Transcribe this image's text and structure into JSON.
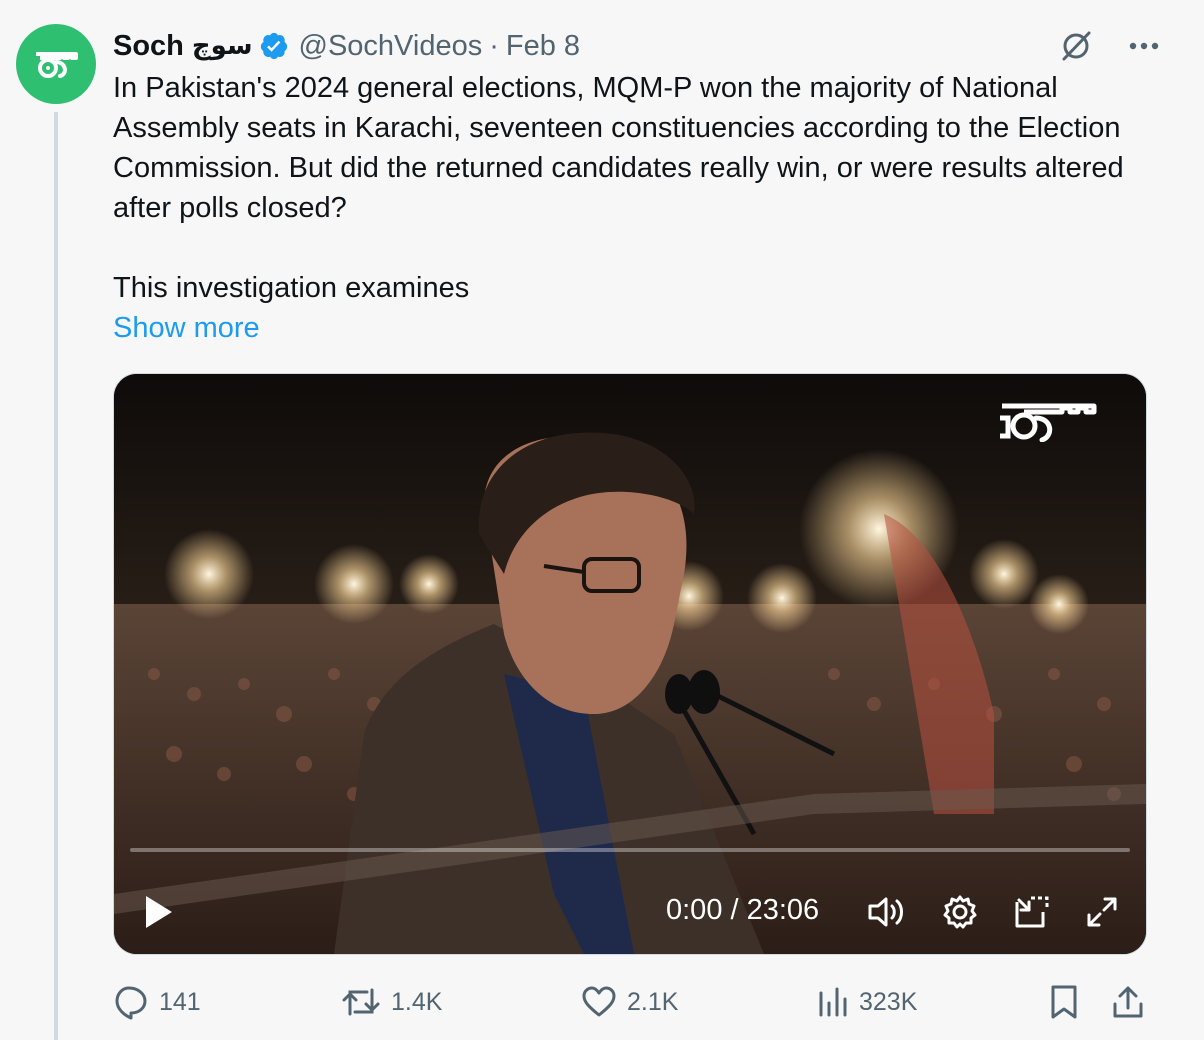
{
  "author": {
    "display_name": "Soch",
    "urdu_name": "سوچ",
    "handle": "@SochVideos",
    "separator": "·",
    "date": "Feb 8"
  },
  "tweet": {
    "text": "In Pakistan's 2024 general elections, MQM-P won the majority of National Assembly seats in Karachi, seventeen constituencies according to the Election Commission. But did the returned candidates really win, or were results altered after polls closed?",
    "text_continued": "This investigation examines",
    "show_more": "Show more"
  },
  "video": {
    "time_display": "0:00 / 23:06",
    "progress_fraction": 0.0
  },
  "engagement": {
    "replies": "141",
    "reposts": "1.4K",
    "likes": "2.1K",
    "views": "323K"
  },
  "icons": {
    "avatar": "soch-logo-icon",
    "verified": "verified-badge-icon",
    "grok": "grok-icon",
    "more": "more-icon",
    "play": "play-icon",
    "volume": "volume-icon",
    "settings": "settings-gear-icon",
    "pip": "picture-in-picture-icon",
    "fullscreen": "fullscreen-icon",
    "reply": "reply-icon",
    "repost": "repost-icon",
    "like": "like-icon",
    "views": "views-icon",
    "bookmark": "bookmark-icon",
    "share": "share-icon"
  },
  "colors": {
    "brand_green": "#2fbf71",
    "link_blue": "#1d9bf0",
    "verified_blue": "#1d9bf0",
    "muted_text": "#536471"
  }
}
